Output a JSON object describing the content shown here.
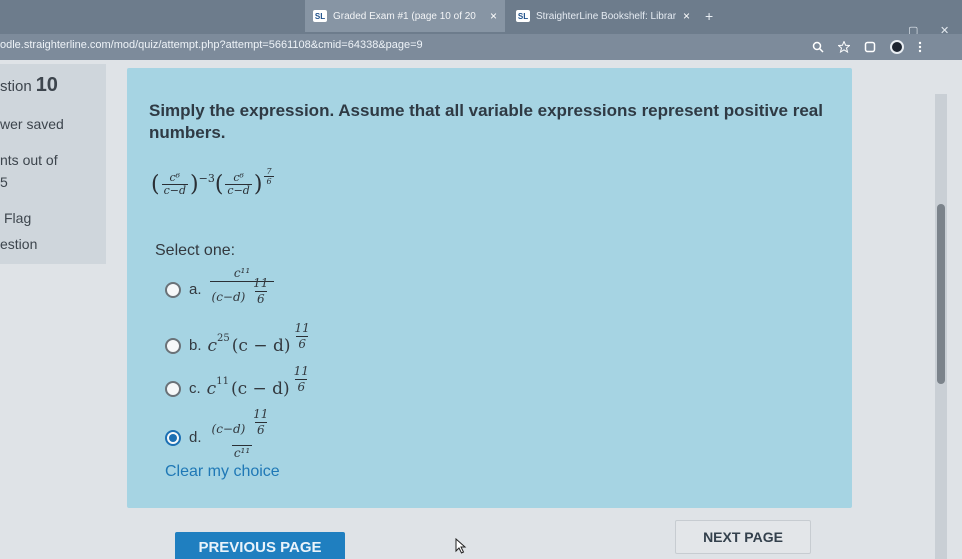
{
  "browser": {
    "tabs": [
      {
        "favicon": "SL",
        "title": "Graded Exam #1 (page 10 of 20",
        "close": "×"
      },
      {
        "favicon": "SL",
        "title": "StraighterLine Bookshelf: Librar",
        "close": "×"
      }
    ],
    "new_tab": "+",
    "url": "odle.straighterline.com/mod/quiz/attempt.php?attempt=5661108&cmid=64338&page=9",
    "minimize": "⎯",
    "restore": "▢",
    "close_window": "✕"
  },
  "sidebar": {
    "question_label": "stion",
    "question_number": "10",
    "status": "wer saved",
    "marks_label": "nts out of",
    "marks_value": "5",
    "flag_label": "Flag",
    "flag_question": "estion"
  },
  "question": {
    "prompt": "Simply the expression. Assume that all variable expressions represent positive real numbers.",
    "expression": {
      "frac_num": "c⁶",
      "frac_den": "c−d",
      "exp1": "−3",
      "exp2_num": "7",
      "exp2_den": "6"
    },
    "select_one": "Select one:",
    "options": [
      {
        "letter": "a.",
        "num": "c¹¹",
        "den_base": "(c−d)",
        "den_exp_num": "11",
        "den_exp_den": "6",
        "selected": false
      },
      {
        "letter": "b.",
        "base": "c",
        "base_exp": "25",
        "paren": "(c − d)",
        "exp_num": "11",
        "exp_den": "6",
        "selected": false
      },
      {
        "letter": "c.",
        "base": "c",
        "base_exp": "11",
        "paren": "(c − d)",
        "exp_num": "11",
        "exp_den": "6",
        "selected": false
      },
      {
        "letter": "d.",
        "num_base": "(c−d)",
        "num_exp_num": "11",
        "num_exp_den": "6",
        "den": "c¹¹",
        "selected": true
      }
    ],
    "clear_choice": "Clear my choice"
  },
  "nav": {
    "previous": "PREVIOUS PAGE",
    "next": "NEXT PAGE"
  },
  "icons": {
    "zoom": "zoom-icon",
    "star": "bookmark-star-icon",
    "extension": "extension-icon",
    "menu": "kebab-menu-icon"
  },
  "colors": {
    "card": "#a6d4e3",
    "accent": "#1f7fc0",
    "link": "#1f78b6"
  }
}
